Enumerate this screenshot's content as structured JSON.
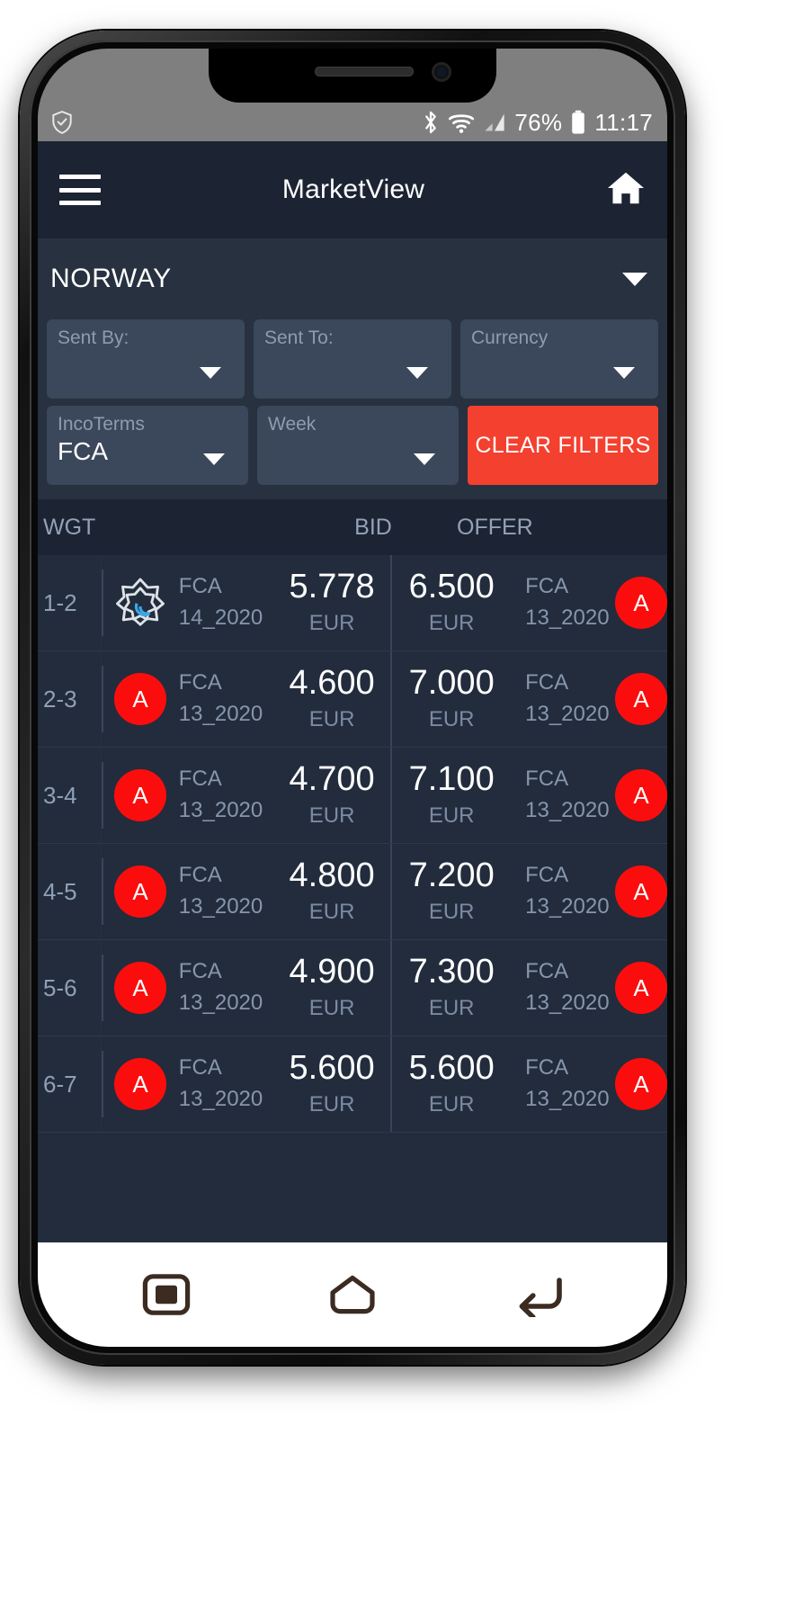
{
  "status_bar": {
    "shield_icon": "shield-check-icon",
    "bluetooth_icon": "bluetooth-icon",
    "wifi_icon": "wifi-icon",
    "signal_icon": "cellular-signal-icon",
    "battery_percent": "76%",
    "battery_icon": "battery-icon",
    "time": "11:17"
  },
  "app_bar": {
    "menu_icon": "hamburger-menu-icon",
    "title": "MarketView",
    "home_icon": "home-icon"
  },
  "country_selector": {
    "value": "NORWAY",
    "caret_icon": "chevron-down-icon"
  },
  "filters": {
    "sent_by": {
      "label": "Sent By:",
      "value": ""
    },
    "sent_to": {
      "label": "Sent To:",
      "value": ""
    },
    "currency": {
      "label": "Currency",
      "value": ""
    },
    "incoterms": {
      "label": "IncoTerms",
      "value": "FCA"
    },
    "week": {
      "label": "Week",
      "value": ""
    },
    "clear_label": "CLEAR FILTERS"
  },
  "table": {
    "headers": {
      "wgt": "WGT",
      "bid": "BID",
      "offer": "OFFER"
    },
    "rows": [
      {
        "wgt": "1-2",
        "bid_avatar": {
          "type": "logo",
          "label": ""
        },
        "bid_terms": "FCA",
        "bid_week": "14_2020",
        "bid_price": "5.778",
        "bid_currency": "EUR",
        "offer_price": "6.500",
        "offer_currency": "EUR",
        "offer_terms": "FCA",
        "offer_week": "13_2020",
        "offer_avatar": {
          "type": "letter",
          "label": "A"
        }
      },
      {
        "wgt": "2-3",
        "bid_avatar": {
          "type": "letter",
          "label": "A"
        },
        "bid_terms": "FCA",
        "bid_week": "13_2020",
        "bid_price": "4.600",
        "bid_currency": "EUR",
        "offer_price": "7.000",
        "offer_currency": "EUR",
        "offer_terms": "FCA",
        "offer_week": "13_2020",
        "offer_avatar": {
          "type": "letter",
          "label": "A"
        }
      },
      {
        "wgt": "3-4",
        "bid_avatar": {
          "type": "letter",
          "label": "A"
        },
        "bid_terms": "FCA",
        "bid_week": "13_2020",
        "bid_price": "4.700",
        "bid_currency": "EUR",
        "offer_price": "7.100",
        "offer_currency": "EUR",
        "offer_terms": "FCA",
        "offer_week": "13_2020",
        "offer_avatar": {
          "type": "letter",
          "label": "A"
        }
      },
      {
        "wgt": "4-5",
        "bid_avatar": {
          "type": "letter",
          "label": "A"
        },
        "bid_terms": "FCA",
        "bid_week": "13_2020",
        "bid_price": "4.800",
        "bid_currency": "EUR",
        "offer_price": "7.200",
        "offer_currency": "EUR",
        "offer_terms": "FCA",
        "offer_week": "13_2020",
        "offer_avatar": {
          "type": "letter",
          "label": "A"
        }
      },
      {
        "wgt": "5-6",
        "bid_avatar": {
          "type": "letter",
          "label": "A"
        },
        "bid_terms": "FCA",
        "bid_week": "13_2020",
        "bid_price": "4.900",
        "bid_currency": "EUR",
        "offer_price": "7.300",
        "offer_currency": "EUR",
        "offer_terms": "FCA",
        "offer_week": "13_2020",
        "offer_avatar": {
          "type": "letter",
          "label": "A"
        }
      },
      {
        "wgt": "6-7",
        "bid_avatar": {
          "type": "letter",
          "label": "A"
        },
        "bid_terms": "FCA",
        "bid_week": "13_2020",
        "bid_price": "5.600",
        "bid_currency": "EUR",
        "offer_price": "5.600",
        "offer_currency": "EUR",
        "offer_terms": "FCA",
        "offer_week": "13_2020",
        "offer_avatar": {
          "type": "letter",
          "label": "A"
        }
      }
    ]
  },
  "nav_bar": {
    "recents_icon": "square-recents-icon",
    "home_icon": "pentagon-home-icon",
    "back_icon": "back-arrow-icon"
  },
  "colors": {
    "accent_red": "#f4402f",
    "avatar_red": "#fc0d0d",
    "app_bar": "#1c2433",
    "panel": "#27313f",
    "field": "#3b475a",
    "table_bg": "#222c3c",
    "muted_text": "#8796ad"
  }
}
